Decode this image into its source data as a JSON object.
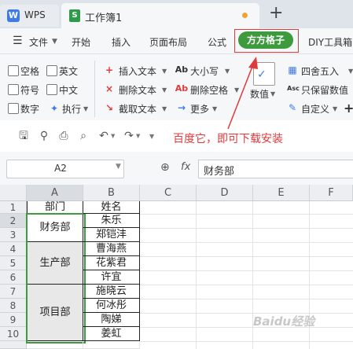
{
  "titlebar": {
    "app_label": "WPS",
    "doc_label": "工作簿1",
    "new_tab": "+"
  },
  "menu": {
    "items": [
      "文件",
      "开始",
      "插入",
      "页面布局",
      "公式",
      "方方格子",
      "DIY工具箱"
    ],
    "active": "方方格子"
  },
  "ribbon": {
    "checkboxes": [
      "空格",
      "英文",
      "符号",
      "中文",
      "数字"
    ],
    "exec_label": "执行",
    "text_ops": [
      "插入文本",
      "删除文本",
      "截取文本"
    ],
    "case_ops": [
      "大小写",
      "删除空格",
      "更多"
    ],
    "value_label": "数值",
    "round_ops": [
      "四舍五入",
      "只保留数值",
      "自定义"
    ]
  },
  "annotation": "百度它，即可下载安装",
  "formula": {
    "cell_ref": "A2",
    "fx": "fx",
    "value": "财务部"
  },
  "grid": {
    "columns": [
      "A",
      "B",
      "C",
      "D",
      "E",
      "F"
    ],
    "rows": [
      "1",
      "2",
      "3",
      "4",
      "5",
      "6",
      "7",
      "8",
      "9",
      "10"
    ],
    "colA": {
      "header": "部门",
      "merged": [
        "财务部",
        "生产部",
        "项目部"
      ]
    },
    "colB": [
      "姓名",
      "朱乐",
      "郑铠沣",
      "曹海燕",
      "花紫君",
      "许宜",
      "施晓云",
      "何冰彤",
      "陶娣",
      "姜虹"
    ]
  },
  "watermark": "Baidu经验",
  "colors": {
    "accent_green": "#3d9a3d",
    "highlight_red": "#e03a3a"
  }
}
